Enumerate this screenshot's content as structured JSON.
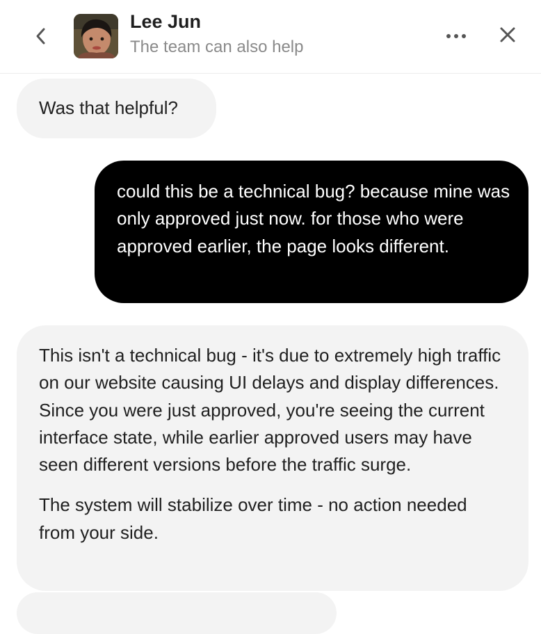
{
  "header": {
    "agent_name": "Lee Jun",
    "agent_subtitle": "The team can also help",
    "back_icon": "chevron-left-icon",
    "more_icon": "more-horizontal-icon",
    "close_icon": "close-icon"
  },
  "messages": [
    {
      "from": "agent",
      "text": "Was that helpful?"
    },
    {
      "from": "user",
      "text": "could this be a technical bug? because mine was only approved just now. for those who were approved earlier, the page looks different."
    },
    {
      "from": "agent",
      "paragraphs": [
        "This isn't a technical bug - it's due to extremely high traffic on our website causing UI delays and display differences. Since you were just approved, you're seeing the current interface state, while earlier approved users may have seen different versions before the traffic surge.",
        "The system will stabilize over time - no action needed from your side."
      ]
    }
  ],
  "colors": {
    "user_bubble": "#000000",
    "agent_bubble": "#f3f3f3",
    "subtitle_text": "#8a8a8a"
  }
}
